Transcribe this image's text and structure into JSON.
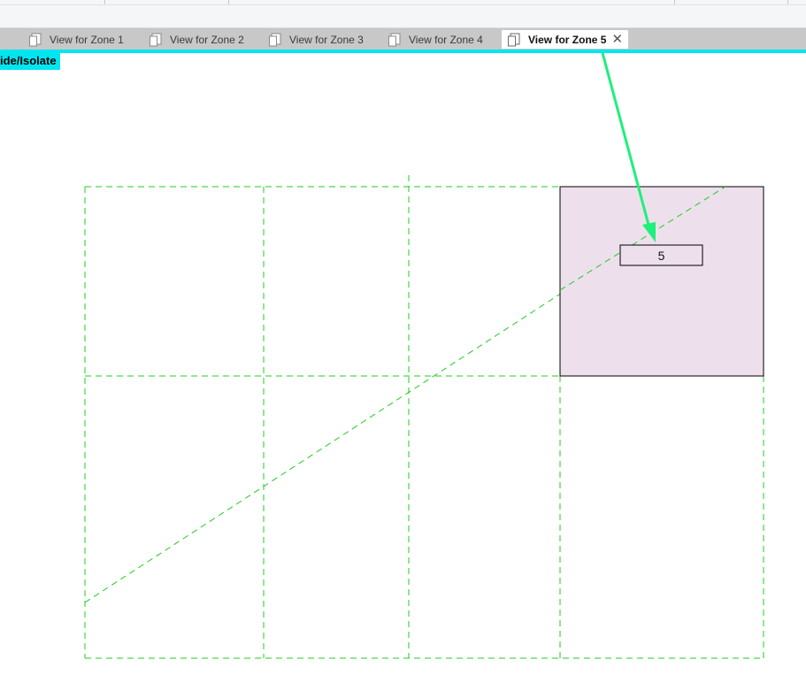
{
  "tabs": [
    {
      "label": "View for Zone 1",
      "active": false
    },
    {
      "label": "View for Zone 2",
      "active": false
    },
    {
      "label": "View for Zone 3",
      "active": false
    },
    {
      "label": "View for Zone 4",
      "active": false
    },
    {
      "label": "View for Zone 5",
      "active": true
    }
  ],
  "active_tab_close_icon": "close-icon",
  "banner": {
    "text": "ide/Isolate"
  },
  "canvas": {
    "selected_zone_label": "5",
    "colors": {
      "accent": "#00e6f0",
      "grid_lines": "#22cc22",
      "selected_zone_fill": "#ede0ec",
      "annotation_arrow": "#1ef07a"
    }
  }
}
